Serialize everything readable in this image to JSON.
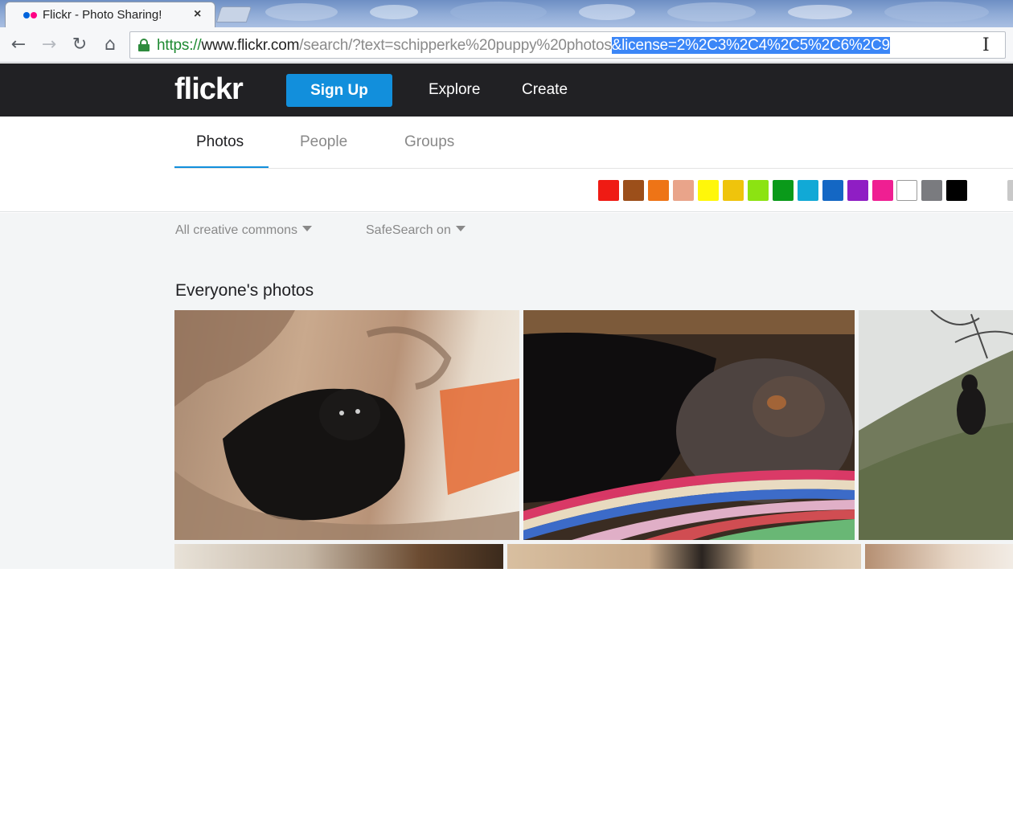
{
  "browser": {
    "tab_title": "Flickr - Photo Sharing!",
    "tab_close": "×",
    "url": {
      "scheme": "https://",
      "host": "www.flickr.com",
      "path": "/search/?text=schipperke%20puppy%20photos",
      "selected": "&license=2%2C3%2C4%2C5%2C6%2C9"
    }
  },
  "header": {
    "logo": "flickr",
    "signup_label": "Sign Up",
    "nav": [
      "Explore",
      "Create"
    ]
  },
  "subnav": {
    "tabs": [
      "Photos",
      "People",
      "Groups"
    ],
    "active_tab": "Photos"
  },
  "color_filters": [
    "#ef1b14",
    "#9c4f1a",
    "#ee7416",
    "#e9a48a",
    "#fff70a",
    "#efc40c",
    "#8ce312",
    "#0a9a1a",
    "#11a9d6",
    "#1467c4",
    "#8f1ec4",
    "#ef1f92",
    "#ffffff",
    "#7a7b7f",
    "#000000"
  ],
  "filters": {
    "license": "All creative commons",
    "safesearch": "SafeSearch on"
  },
  "content": {
    "section_title": "Everyone's photos"
  }
}
